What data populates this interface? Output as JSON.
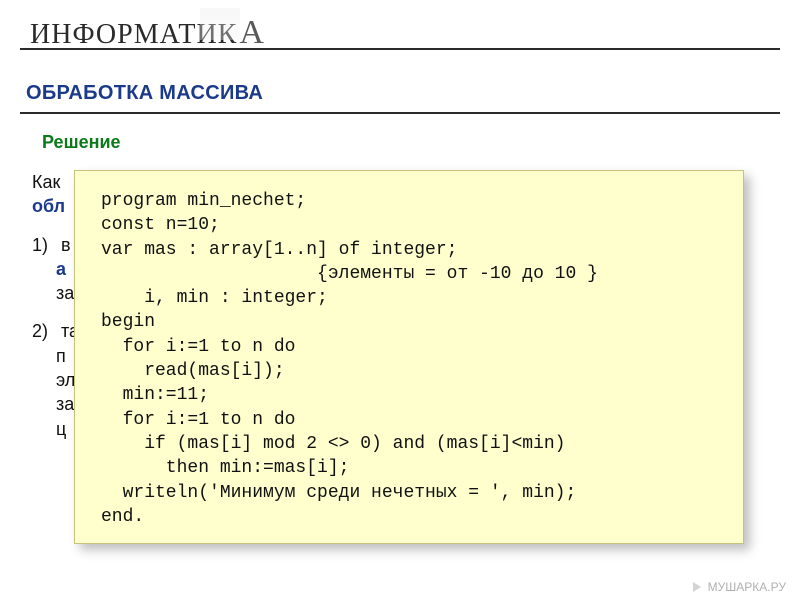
{
  "header": {
    "brand_main": "ИНФОРМАТИК",
    "brand_last": "А"
  },
  "title": "ОБРАБОТКА МАССИВА",
  "subhead": "Решение",
  "body": {
    "intro_l1": "Как",
    "intro_l2": "обл",
    "item1_num": "1)",
    "item1_a": "в",
    "item1_b": "а",
    "item1_c": "за",
    "item2_num": "2)",
    "item2_a": "та",
    "item2_b": "п",
    "item2_c": "эл",
    "item2_d": "за",
    "item2_e": "ц"
  },
  "code": "program min_nechet;\nconst n=10;\nvar mas : array[1..n] of integer;\n                    {элементы = от -10 до 10 }\n    i, min : integer;\nbegin\n  for i:=1 to n do\n    read(mas[i]);\n  min:=11;\n  for i:=1 to n do\n    if (mas[i] mod 2 <> 0) and (mas[i]<min)\n      then min:=mas[i];\n  writeln('Минимум среди нечетных = ', min);\nend.",
  "watermark": "МУШАРКА.РУ"
}
